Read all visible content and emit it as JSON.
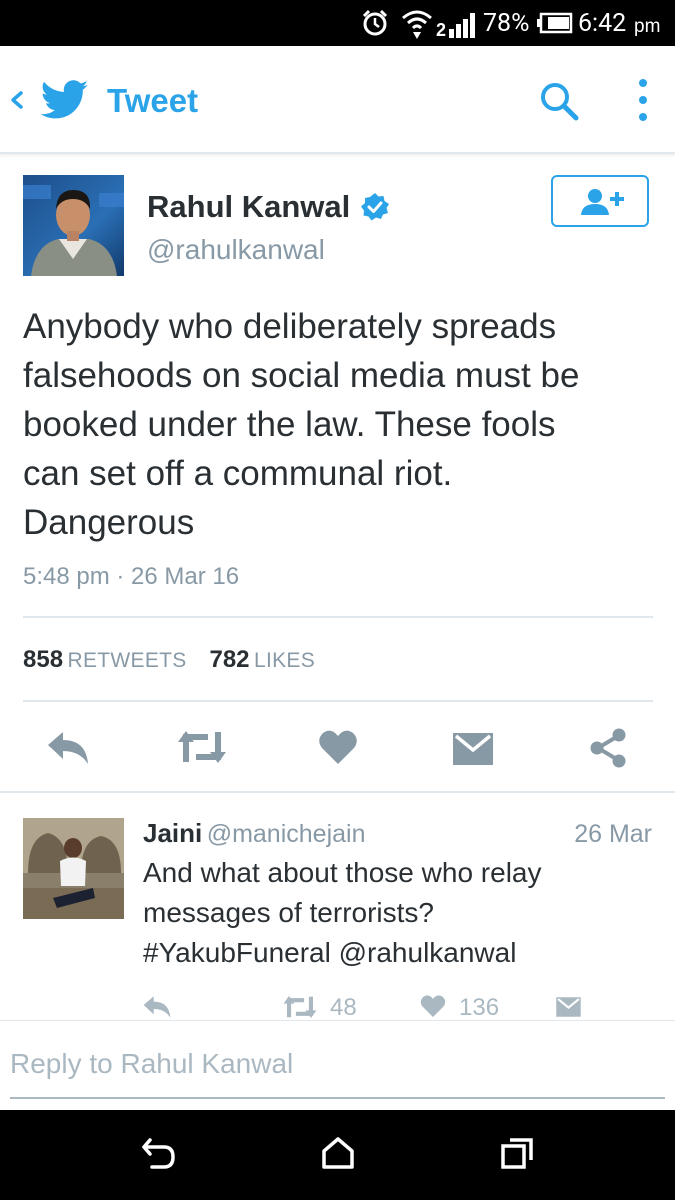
{
  "status_bar": {
    "battery": "78%",
    "time": "6:42",
    "ampm": "pm"
  },
  "app_bar": {
    "title": "Tweet"
  },
  "tweet": {
    "author_name": "Rahul Kanwal",
    "author_handle": "@rahulkanwal",
    "verified": true,
    "text_lines": [
      "Anybody who deliberately spreads",
      "falsehoods on social media must be",
      "booked under the law. These fools",
      "can set off a communal riot.",
      "Dangerous"
    ],
    "timestamp": "5:48 pm · 26 Mar 16",
    "retweets_count": "858",
    "retweets_label": "RETWEETS",
    "likes_count": "782",
    "likes_label": "LIKES"
  },
  "reply": {
    "author_name": "Jaini",
    "author_handle": "@manichejain",
    "date": "26 Mar",
    "text_lines": [
      "And what about those who relay",
      "messages of terrorists?",
      "#YakubFuneral @rahulkanwal"
    ],
    "retweets": "48",
    "likes": "136"
  },
  "reply_box": {
    "placeholder": "Reply to Rahul Kanwal"
  },
  "colors": {
    "accent": "#2ba3e8",
    "icon_gray": "#8899a6",
    "text": "#292f33",
    "muted": "#8899a6"
  }
}
